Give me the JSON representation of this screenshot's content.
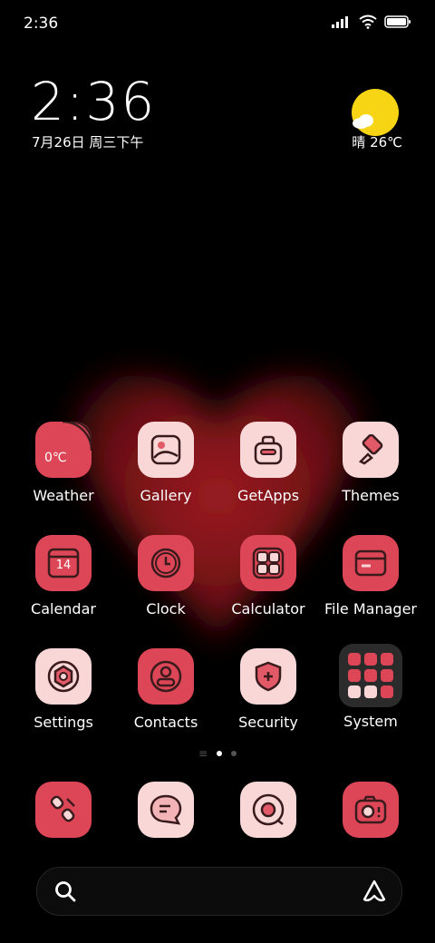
{
  "status_bar": {
    "time": "2:36",
    "icons": [
      "signal-icon",
      "wifi-icon",
      "battery-icon"
    ]
  },
  "clock_widget": {
    "time": "2:36",
    "date": "7月26日 周三下午"
  },
  "weather_widget": {
    "condition": "晴",
    "temperature": "26℃",
    "icon": "sunny-cloud-icon"
  },
  "apps": [
    {
      "name": "weather",
      "label": "Weather",
      "icon_text": "0℃"
    },
    {
      "name": "gallery",
      "label": "Gallery"
    },
    {
      "name": "getapps",
      "label": "GetApps"
    },
    {
      "name": "themes",
      "label": "Themes"
    },
    {
      "name": "calendar",
      "label": "Calendar",
      "icon_text": "14"
    },
    {
      "name": "clock",
      "label": "Clock"
    },
    {
      "name": "calculator",
      "label": "Calculator"
    },
    {
      "name": "file-manager",
      "label": "File Manager"
    },
    {
      "name": "settings",
      "label": "Settings"
    },
    {
      "name": "contacts",
      "label": "Contacts"
    },
    {
      "name": "security",
      "label": "Security"
    },
    {
      "name": "system",
      "label": "System"
    }
  ],
  "dock": [
    {
      "name": "phone"
    },
    {
      "name": "messages"
    },
    {
      "name": "browser"
    },
    {
      "name": "camera"
    }
  ],
  "page_indicator": {
    "pages": 2,
    "active": 1
  },
  "search_bar": {
    "left_icon": "search-icon",
    "right_icon": "assistant-icon"
  },
  "colors": {
    "accent_red": "#dd4656",
    "accent_pink": "#f8d7d6",
    "dark_icon": "#3a1b1d"
  }
}
